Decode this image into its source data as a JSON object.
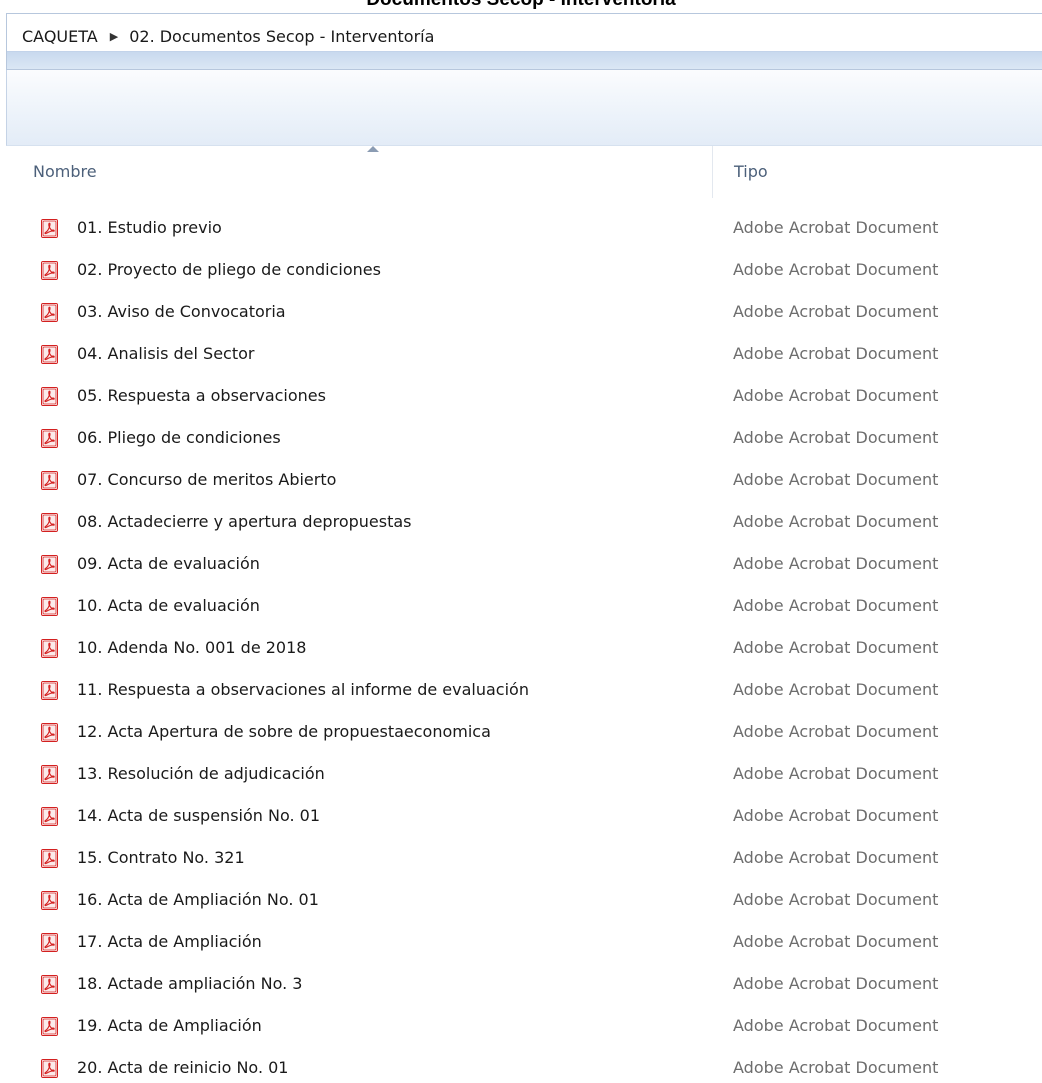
{
  "title": "Documentos Secop - Interventoría",
  "address_bar": {
    "crumbs": [
      "CAQUETA",
      "02. Documentos Secop - Interventoría"
    ],
    "separator": "▶"
  },
  "columns": {
    "name": "Nombre",
    "type": "Tipo"
  },
  "files": [
    {
      "name": "01. Estudio previo",
      "type": "Adobe Acrobat Document"
    },
    {
      "name": "02. Proyecto de pliego de condiciones",
      "type": "Adobe Acrobat Document"
    },
    {
      "name": "03. Aviso de Convocatoria",
      "type": "Adobe Acrobat Document"
    },
    {
      "name": "04. Analisis del Sector",
      "type": "Adobe Acrobat Document"
    },
    {
      "name": "05. Respuesta a observaciones",
      "type": "Adobe Acrobat Document"
    },
    {
      "name": "06. Pliego de condiciones",
      "type": "Adobe Acrobat Document"
    },
    {
      "name": "07. Concurso de meritos Abierto",
      "type": "Adobe Acrobat Document"
    },
    {
      "name": "08. Actadecierre y apertura depropuestas",
      "type": "Adobe Acrobat Document"
    },
    {
      "name": "09. Acta de evaluación",
      "type": "Adobe Acrobat Document"
    },
    {
      "name": "10. Acta de evaluación",
      "type": "Adobe Acrobat Document"
    },
    {
      "name": "10. Adenda No. 001 de 2018",
      "type": "Adobe Acrobat Document"
    },
    {
      "name": "11. Respuesta a observaciones al informe de evaluación",
      "type": "Adobe Acrobat Document"
    },
    {
      "name": "12. Acta Apertura de sobre de propuestaeconomica",
      "type": "Adobe Acrobat Document"
    },
    {
      "name": "13. Resolución de adjudicación",
      "type": "Adobe Acrobat Document"
    },
    {
      "name": "14. Acta de suspensión No. 01",
      "type": "Adobe Acrobat Document"
    },
    {
      "name": "15. Contrato No. 321",
      "type": "Adobe Acrobat Document"
    },
    {
      "name": "16. Acta de Ampliación No. 01",
      "type": "Adobe Acrobat Document"
    },
    {
      "name": "17. Acta de Ampliación",
      "type": "Adobe Acrobat Document"
    },
    {
      "name": "18. Actade ampliación No. 3",
      "type": "Adobe Acrobat Document"
    },
    {
      "name": "19. Acta de Ampliación",
      "type": "Adobe Acrobat Document"
    },
    {
      "name": "20. Acta de reinicio No. 01",
      "type": "Adobe Acrobat Document"
    }
  ],
  "icons": {
    "file_icon": "pdf-file-icon",
    "sort_icon": "sort-ascending-icon"
  },
  "colors": {
    "pdf_red": "#d32020",
    "address_strip": "#c8d9ee",
    "header_text": "#4c607a",
    "type_text": "#6d6d6d"
  }
}
